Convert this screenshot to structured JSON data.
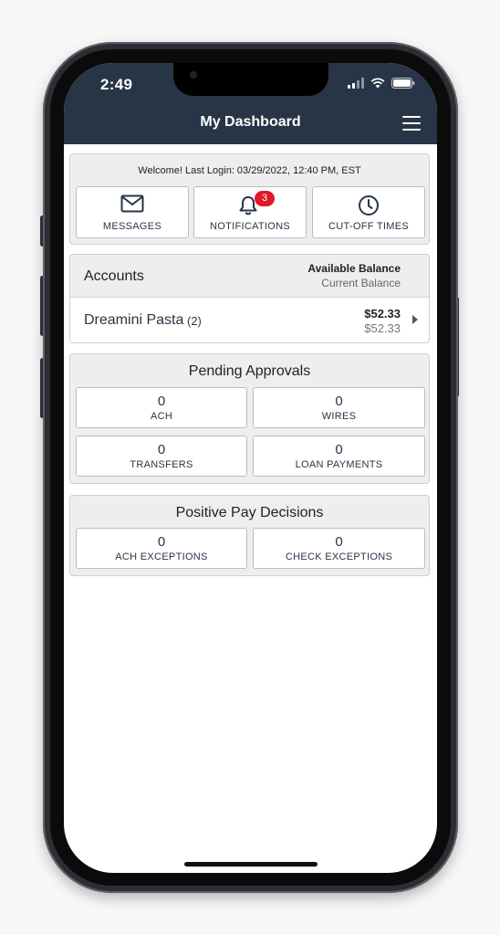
{
  "status_bar": {
    "time": "2:49"
  },
  "header": {
    "title": "My Dashboard"
  },
  "welcome": {
    "text": "Welcome! Last Login: 03/29/2022, 12:40 PM, EST"
  },
  "quick_tiles": [
    {
      "label": "MESSAGES",
      "icon": "envelope-icon"
    },
    {
      "label": "NOTIFICATIONS",
      "icon": "bell-icon",
      "badge": "3"
    },
    {
      "label": "CUT-OFF TIMES",
      "icon": "clock-icon"
    }
  ],
  "accounts": {
    "title": "Accounts",
    "available_label": "Available Balance",
    "current_label": "Current Balance",
    "items": [
      {
        "name": "Dreamini Pasta",
        "count": "(2)",
        "available": "$52.33",
        "current": "$52.33"
      }
    ]
  },
  "pending_approvals": {
    "title": "Pending Approvals",
    "items": [
      {
        "value": "0",
        "label": "ACH"
      },
      {
        "value": "0",
        "label": "WIRES"
      },
      {
        "value": "0",
        "label": "TRANSFERS"
      },
      {
        "value": "0",
        "label": "LOAN PAYMENTS"
      }
    ]
  },
  "positive_pay": {
    "title": "Positive Pay Decisions",
    "items": [
      {
        "value": "0",
        "label": "ACH EXCEPTIONS"
      },
      {
        "value": "0",
        "label": "CHECK EXCEPTIONS"
      }
    ]
  },
  "colors": {
    "header": "#283546",
    "badge": "#e0192a",
    "text": "#283546"
  }
}
